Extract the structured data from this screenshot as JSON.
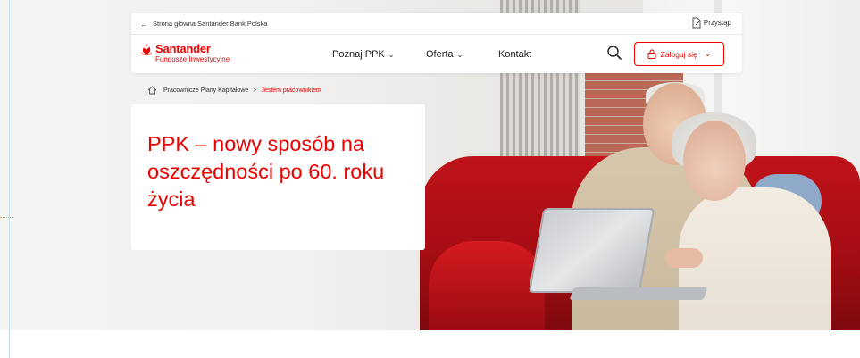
{
  "topbar": {
    "back_link": "Strona główna Santander Bank Polska",
    "przystap": "Przystąp"
  },
  "logo": {
    "name": "Santander",
    "subtitle": "Fundusze Inwestycyjne"
  },
  "menu": {
    "items": [
      {
        "label": "Poznaj PPK"
      },
      {
        "label": "Oferta"
      },
      {
        "label": "Kontakt"
      }
    ]
  },
  "login": {
    "label": "Zaloguj się"
  },
  "breadcrumb": {
    "home": "Pracownicze Plany Kapitałowe",
    "separator": ">",
    "current": "Jestem pracownikiem"
  },
  "hero": {
    "title": "PPK – nowy sposób na oszczędności po 60. roku życia"
  },
  "colors": {
    "brand": "#ec0000",
    "text": "#222222"
  }
}
